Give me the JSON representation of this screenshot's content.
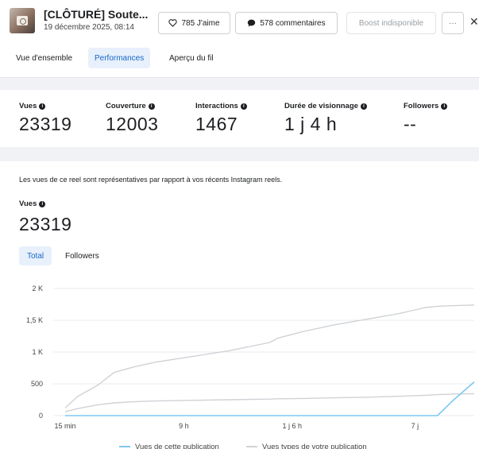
{
  "header": {
    "title": "[CLÔTURÉ] Soute...",
    "date": "19 décembre 2025, 08:14",
    "likes_label": "785 J'aime",
    "comments_label": "578 commentaires",
    "boost_label": "Boost indisponible",
    "more_label": "···",
    "close_label": "✕"
  },
  "tabs": [
    {
      "label": "Vue d'ensemble"
    },
    {
      "label": "Performances",
      "active": true
    },
    {
      "label": "Aperçu du fil"
    }
  ],
  "metrics": [
    {
      "label": "Vues",
      "value": "23319"
    },
    {
      "label": "Couverture",
      "value": "12003"
    },
    {
      "label": "Interactions",
      "value": "1467"
    },
    {
      "label": "Durée de visionnage",
      "value": "1 j 4 h"
    },
    {
      "label": "Followers",
      "value": "--"
    }
  ],
  "description": "Les vues de ce reel sont représentatives par rapport à vos récents Instagram reels.",
  "views": {
    "label": "Vues",
    "value": "23319"
  },
  "segments": [
    {
      "label": "Total",
      "active": true
    },
    {
      "label": "Followers"
    }
  ],
  "colors": {
    "accent": "#1968c8",
    "this_post": "#7ec8f0",
    "typical": "#cfd2d6"
  },
  "chart_data": {
    "type": "line",
    "x_ticks": [
      "15 min",
      "9 h",
      "1 j 6 h",
      "7 j"
    ],
    "y_ticks": [
      "0",
      "500",
      "1 K",
      "1,5 K",
      "2 K"
    ],
    "ylim": [
      0,
      2000
    ],
    "x": [
      0,
      0.03,
      0.08,
      0.12,
      0.17,
      0.22,
      0.3,
      0.4,
      0.5,
      0.52,
      0.58,
      0.66,
      0.74,
      0.82,
      0.88,
      0.91,
      0.95,
      1.0
    ],
    "series": [
      {
        "name": "Vues de cette publication",
        "color": "#7ec8f0",
        "values": [
          0,
          0,
          0,
          0,
          0,
          0,
          0,
          0,
          0,
          0,
          0,
          0,
          0,
          0,
          0,
          0,
          250,
          530
        ]
      },
      {
        "name": "Vues types de votre publication",
        "color": "#cfd2d6",
        "values": [
          120,
          300,
          480,
          680,
          770,
          840,
          920,
          1020,
          1150,
          1220,
          1320,
          1430,
          1520,
          1610,
          1700,
          1720,
          1730,
          1740
        ]
      },
      {
        "name": "",
        "color": "#cfd2d6",
        "values": [
          60,
          110,
          170,
          200,
          220,
          230,
          240,
          250,
          260,
          265,
          270,
          280,
          290,
          305,
          320,
          330,
          340,
          345
        ]
      }
    ],
    "grid": true
  }
}
